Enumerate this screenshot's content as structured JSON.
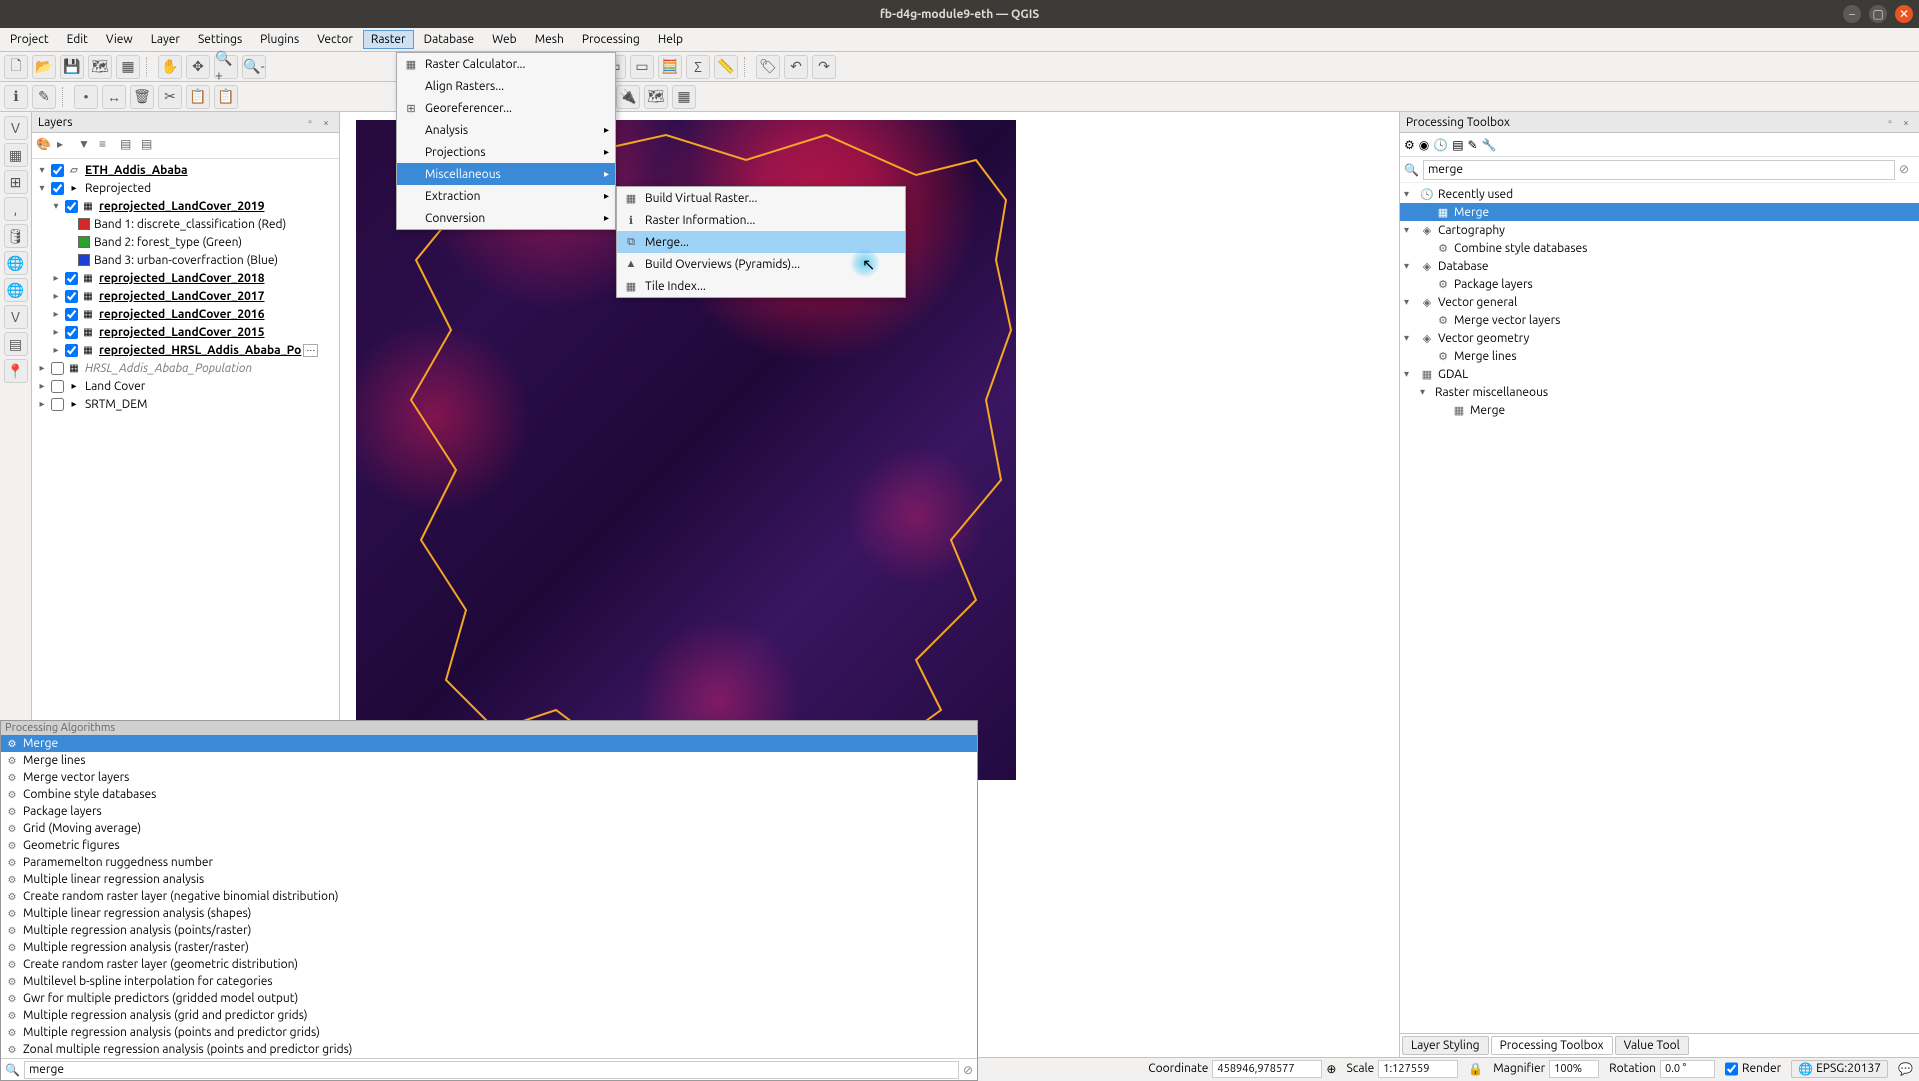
{
  "window": {
    "title": "fb-d4g-module9-eth — QGIS"
  },
  "menubar": [
    "Project",
    "Edit",
    "View",
    "Layer",
    "Settings",
    "Plugins",
    "Vector",
    "Raster",
    "Database",
    "Web",
    "Mesh",
    "Processing",
    "Help"
  ],
  "menubar_active": "Raster",
  "raster_menu": {
    "items": [
      {
        "label": "Raster Calculator...",
        "sub": false
      },
      {
        "label": "Align Rasters...",
        "sub": false
      },
      {
        "label": "Georeferencer...",
        "sub": false
      },
      {
        "label": "Analysis",
        "sub": true
      },
      {
        "label": "Projections",
        "sub": true
      },
      {
        "label": "Miscellaneous",
        "sub": true,
        "hl": true
      },
      {
        "label": "Extraction",
        "sub": true
      },
      {
        "label": "Conversion",
        "sub": true
      }
    ]
  },
  "misc_menu": {
    "items": [
      {
        "label": "Build Virtual Raster..."
      },
      {
        "label": "Raster Information..."
      },
      {
        "label": "Merge...",
        "hl": true
      },
      {
        "label": "Build Overviews (Pyramids)..."
      },
      {
        "label": "Tile Index..."
      }
    ]
  },
  "layers_panel": {
    "title": "Layers",
    "tree": [
      {
        "lvl": 0,
        "exp": "▾",
        "chk": true,
        "bold": true,
        "name": "ETH_Addis_Ababa",
        "icon": "poly"
      },
      {
        "lvl": 0,
        "exp": "▾",
        "chk": true,
        "name": "Reprojected",
        "icon": "group"
      },
      {
        "lvl": 1,
        "exp": "▾",
        "chk": true,
        "bold": true,
        "under": true,
        "name": "reprojected_LandCover_2019",
        "icon": "raster"
      },
      {
        "lvl": 2,
        "swatch": "red",
        "name": "Band 1: discrete_classification (Red)"
      },
      {
        "lvl": 2,
        "swatch": "green",
        "name": "Band 2: forest_type (Green)"
      },
      {
        "lvl": 2,
        "swatch": "blue",
        "name": "Band 3: urban-coverfraction (Blue)"
      },
      {
        "lvl": 1,
        "exp": "▸",
        "chk": true,
        "bold": true,
        "name": "reprojected_LandCover_2018",
        "icon": "raster"
      },
      {
        "lvl": 1,
        "exp": "▸",
        "chk": true,
        "bold": true,
        "name": "reprojected_LandCover_2017",
        "icon": "raster"
      },
      {
        "lvl": 1,
        "exp": "▸",
        "chk": true,
        "bold": true,
        "name": "reprojected_LandCover_2016",
        "icon": "raster"
      },
      {
        "lvl": 1,
        "exp": "▸",
        "chk": true,
        "bold": true,
        "name": "reprojected_LandCover_2015",
        "icon": "raster"
      },
      {
        "lvl": 1,
        "exp": "▸",
        "chk": true,
        "bold": true,
        "name": "reprojected_HRSL_Addis_Ababa_Po",
        "icon": "raster",
        "trunc": true
      },
      {
        "lvl": 0,
        "exp": "▸",
        "chk": false,
        "italic": true,
        "name": "HRSL_Addis_Ababa_Population",
        "icon": "raster"
      },
      {
        "lvl": 0,
        "exp": "▸",
        "chk": false,
        "name": "Land Cover",
        "icon": "group"
      },
      {
        "lvl": 0,
        "exp": "▸",
        "chk": false,
        "name": "SRTM_DEM",
        "icon": "group"
      }
    ]
  },
  "algo_popup": {
    "header": "Processing Algorithms",
    "items": [
      {
        "name": "Merge",
        "sel": true
      },
      {
        "name": "Merge lines"
      },
      {
        "name": "Merge vector layers"
      },
      {
        "name": "Combine style databases"
      },
      {
        "name": "Package layers"
      },
      {
        "name": "Grid (Moving average)"
      },
      {
        "name": "Geometric figures"
      },
      {
        "name": "Paramemelton ruggedness number"
      },
      {
        "name": "Multiple linear regression analysis"
      },
      {
        "name": "Create random raster layer (negative binomial distribution)"
      },
      {
        "name": "Multiple linear regression analysis (shapes)"
      },
      {
        "name": "Multiple regression analysis (points/raster)"
      },
      {
        "name": "Multiple regression analysis (raster/raster)"
      },
      {
        "name": "Create random raster layer (geometric distribution)"
      },
      {
        "name": "Multilevel b-spline interpolation for categories"
      },
      {
        "name": "Gwr for multiple predictors (gridded model output)"
      },
      {
        "name": "Multiple regression analysis (grid and predictor grids)"
      },
      {
        "name": "Multiple regression analysis (points and predictor grids)"
      },
      {
        "name": "Zonal multiple regression analysis (points and predictor grids)"
      }
    ],
    "search_value": "merge"
  },
  "toolbox": {
    "title": "Processing Toolbox",
    "search": "merge",
    "tree": [
      {
        "lvl": 0,
        "exp": "▾",
        "icon": "clock",
        "name": "Recently used"
      },
      {
        "lvl": 1,
        "sel": true,
        "icon": "gdal",
        "name": "Merge"
      },
      {
        "lvl": 0,
        "exp": "▾",
        "icon": "q",
        "name": "Cartography"
      },
      {
        "lvl": 1,
        "icon": "gear",
        "name": "Combine style databases"
      },
      {
        "lvl": 0,
        "exp": "▾",
        "icon": "q",
        "name": "Database"
      },
      {
        "lvl": 1,
        "icon": "gear",
        "name": "Package layers"
      },
      {
        "lvl": 0,
        "exp": "▾",
        "icon": "q",
        "name": "Vector general"
      },
      {
        "lvl": 1,
        "icon": "gear",
        "name": "Merge vector layers"
      },
      {
        "lvl": 0,
        "exp": "▾",
        "icon": "q",
        "name": "Vector geometry"
      },
      {
        "lvl": 1,
        "icon": "gear",
        "name": "Merge lines"
      },
      {
        "lvl": 0,
        "exp": "▾",
        "icon": "gdal",
        "name": "GDAL"
      },
      {
        "lvl": 1,
        "exp": "▾",
        "name": "Raster miscellaneous"
      },
      {
        "lvl": 2,
        "icon": "gdal",
        "name": "Merge"
      }
    ],
    "tabs": [
      "Layer Styling",
      "Processing Toolbox",
      "Value Tool"
    ],
    "active_tab": "Processing Toolbox"
  },
  "statusbar": {
    "coordinate_label": "Coordinate",
    "coordinate": "458946,978577",
    "scale_label": "Scale",
    "scale": "1:127559",
    "magnifier_label": "Magnifier",
    "magnifier": "100%",
    "rotation_label": "Rotation",
    "rotation": "0.0 °",
    "render_label": "Render",
    "epsg": "EPSG:20137"
  }
}
